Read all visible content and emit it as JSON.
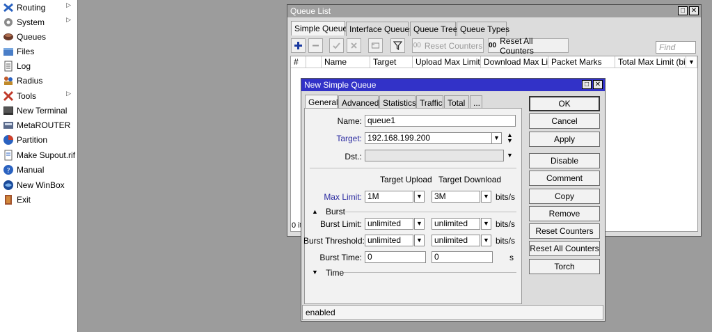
{
  "menu": {
    "items": [
      {
        "label": "Routing",
        "icon": "routing-icon",
        "submenu": true
      },
      {
        "label": "System",
        "icon": "gear-icon",
        "submenu": true
      },
      {
        "label": "Queues",
        "icon": "queues-icon",
        "submenu": false
      },
      {
        "label": "Files",
        "icon": "folder-icon",
        "submenu": false
      },
      {
        "label": "Log",
        "icon": "log-icon",
        "submenu": false
      },
      {
        "label": "Radius",
        "icon": "radius-icon",
        "submenu": false
      },
      {
        "label": "Tools",
        "icon": "tools-icon",
        "submenu": true
      },
      {
        "label": "New Terminal",
        "icon": "terminal-icon",
        "submenu": false
      },
      {
        "label": "MetaROUTER",
        "icon": "metarouter-icon",
        "submenu": false
      },
      {
        "label": "Partition",
        "icon": "partition-icon",
        "submenu": false
      },
      {
        "label": "Make Supout.rif",
        "icon": "file-icon",
        "submenu": false
      },
      {
        "label": "Manual",
        "icon": "help-icon",
        "submenu": false
      },
      {
        "label": "New WinBox",
        "icon": "winbox-icon",
        "submenu": false
      },
      {
        "label": "Exit",
        "icon": "exit-icon",
        "submenu": false
      }
    ]
  },
  "queue_list": {
    "title": "Queue List",
    "tabs": [
      "Simple Queues",
      "Interface Queues",
      "Queue Tree",
      "Queue Types"
    ],
    "toolbar": {
      "reset_counters": "Reset Counters",
      "reset_all_counters": "Reset All Counters",
      "counter_prefix": "00",
      "find_placeholder": "Find"
    },
    "columns": [
      "#",
      "Name",
      "Target",
      "Upload Max Limit",
      "Download Max Limit",
      "Packet Marks",
      "Total Max Limit (bi..."
    ],
    "footer": "0 it"
  },
  "dialog": {
    "title": "New Simple Queue",
    "tabs": [
      "General",
      "Advanced",
      "Statistics",
      "Traffic",
      "Total",
      "..."
    ],
    "name_label": "Name:",
    "name_value": "queue1",
    "target_label": "Target:",
    "target_value": "192.168.199.200",
    "dst_label": "Dst.:",
    "dst_value": "",
    "target_upload": "Target Upload",
    "target_download": "Target Download",
    "max_limit_label": "Max Limit:",
    "max_limit_upload": "1M",
    "max_limit_download": "3M",
    "unit": "bits/s",
    "burst_section": "Burst",
    "burst_limit_label": "Burst Limit:",
    "burst_limit_upload": "unlimited",
    "burst_limit_download": "unlimited",
    "burst_threshold_label": "Burst Threshold:",
    "burst_threshold_upload": "unlimited",
    "burst_threshold_download": "unlimited",
    "burst_time_label": "Burst Time:",
    "burst_time_upload": "0",
    "burst_time_download": "0",
    "burst_time_unit": "s",
    "time_section": "Time",
    "buttons": [
      "OK",
      "Cancel",
      "Apply",
      "Disable",
      "Comment",
      "Copy",
      "Remove",
      "Reset Counters",
      "Reset All Counters",
      "Torch"
    ],
    "status": "enabled"
  },
  "colors": {
    "dialog_title": "#3232c8",
    "inactive_title": "#a0a0a0",
    "label_blue": "#2a2aa0",
    "desktop": "#9c9c9c"
  }
}
